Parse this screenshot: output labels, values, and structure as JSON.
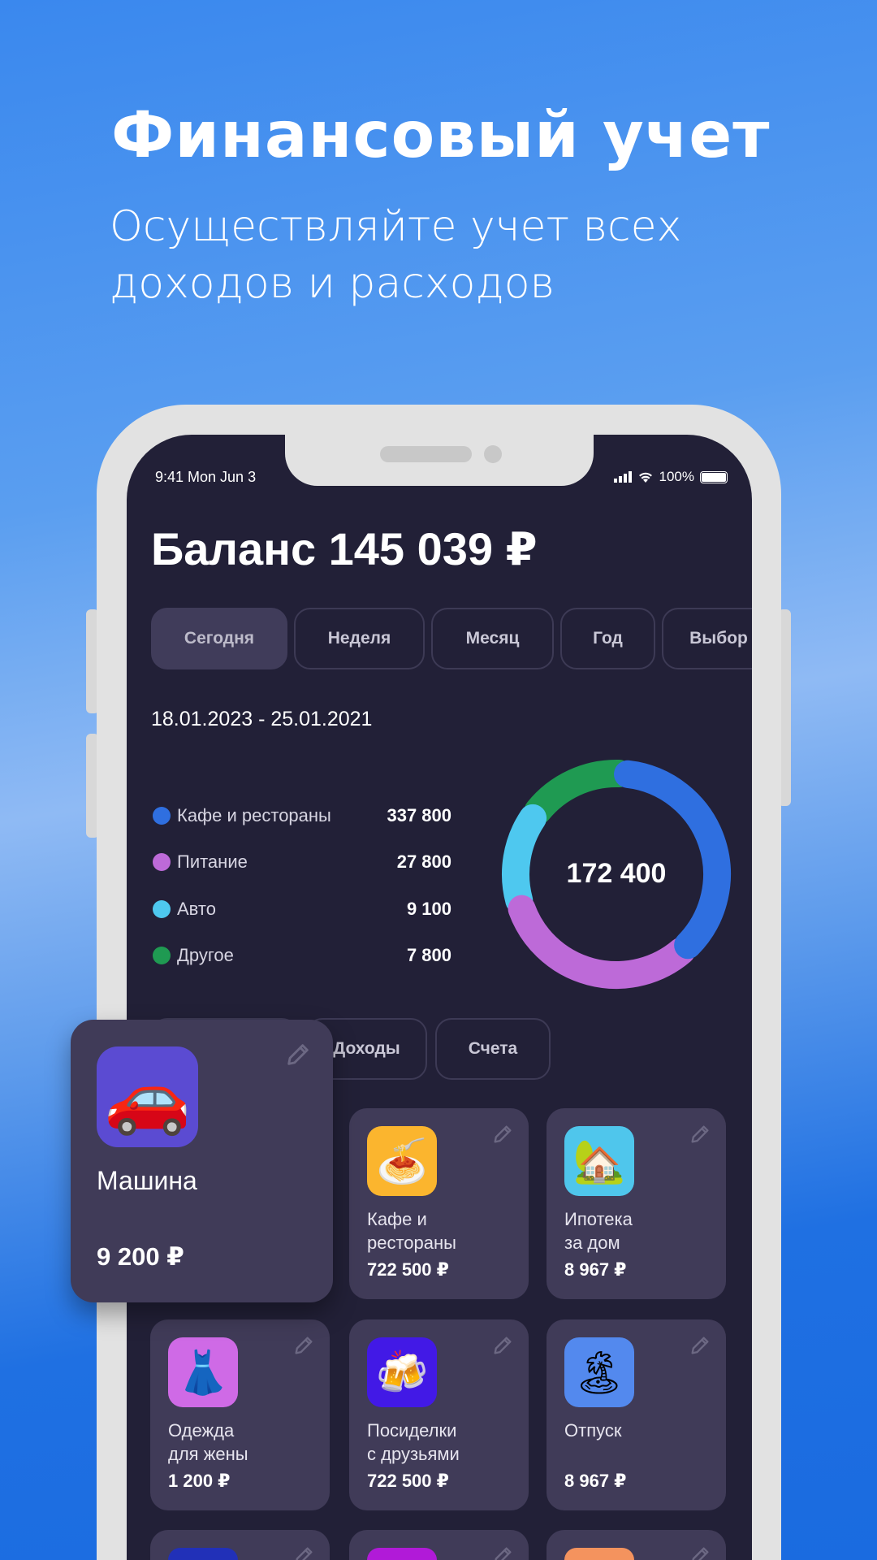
{
  "hero": {
    "title": "Финансовый учет",
    "subtitle_line1": "Осуществляйте учет всех",
    "subtitle_line2": "доходов и расходов"
  },
  "status": {
    "time": "9:41  Mon Jun 3",
    "battery": "100%"
  },
  "balance": "Баланс  145 039 ₽",
  "period_tabs": [
    {
      "label": "Сегодня",
      "active": true
    },
    {
      "label": "Неделя"
    },
    {
      "label": "Месяц"
    },
    {
      "label": "Год"
    },
    {
      "label": "Выбор"
    }
  ],
  "date_range": "18.01.2023 - 25.01.2021",
  "legend": [
    {
      "label": "Кафе и рестораны",
      "value": "337 800",
      "color": "#2f6fe0"
    },
    {
      "label": "Питание",
      "value": "27 800",
      "color": "#bd6ad8"
    },
    {
      "label": "Авто",
      "value": "9 100",
      "color": "#4ec8ef"
    },
    {
      "label": "Другое",
      "value": "7 800",
      "color": "#1f9a52"
    }
  ],
  "donut": {
    "total": "172 400",
    "arc_share_percent": [
      37,
      32,
      15,
      16
    ]
  },
  "section_tabs": [
    {
      "label": ""
    },
    {
      "label": "Доходы"
    },
    {
      "label": "Счета"
    }
  ],
  "featured_card": {
    "name": "Машина",
    "amount": "9 200 ₽",
    "icon": "car-icon",
    "icon_glyph": "🚗",
    "icon_bg": "#5b4bd2"
  },
  "cards": [
    {
      "name": "Кафе и\nрестораны",
      "amount": "722 500 ₽",
      "icon": "spaghetti-icon",
      "icon_glyph": "🍝",
      "icon_bg": "#fbb52e"
    },
    {
      "name": "Ипотека\nза дом",
      "amount": "8 967 ₽",
      "icon": "house-icon",
      "icon_glyph": "🏡",
      "icon_bg": "#4fc6ec"
    },
    {
      "name": "Одежда\nдля жены",
      "amount": "1 200 ₽",
      "icon": "dress-icon",
      "icon_glyph": "👗",
      "icon_bg": "#cf6ae6"
    },
    {
      "name": "Посиделки\nс друзьями",
      "amount": "722 500 ₽",
      "icon": "beer-icon",
      "icon_glyph": "🍻",
      "icon_bg": "#4219e6"
    },
    {
      "name": "Отпуск",
      "amount": "8 967 ₽",
      "icon": "beach-icon",
      "icon_glyph": "🏝",
      "icon_bg": "#5389ee"
    }
  ],
  "partial_cards": [
    {
      "icon_bg": "#2130b8"
    },
    {
      "icon_bg": "#b11ad8"
    },
    {
      "icon_bg": "#f4935e"
    }
  ]
}
